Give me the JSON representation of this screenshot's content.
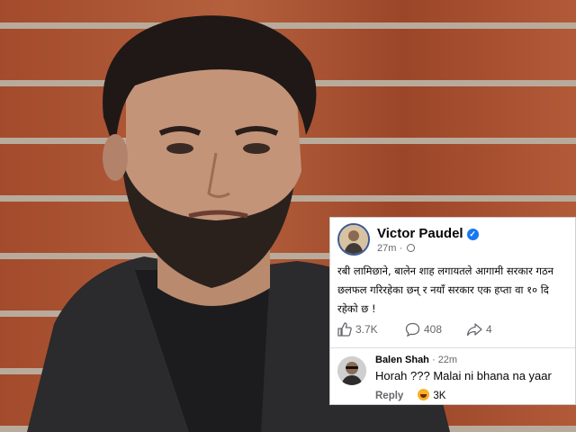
{
  "post": {
    "author": "Victor Paudel",
    "time": "27m",
    "body_lines": [
      "रबी लामिछाने, बालेन शाह लगायतले आगामी सरकार गठन",
      "छलफल गरिरहेका छन् र नयाँ सरकार एक हप्ता वा १० दि",
      "रहेको छ !"
    ],
    "likes": "3.7K",
    "comments": "408",
    "shares": "4"
  },
  "comment": {
    "author": "Balen Shah",
    "time": "22m",
    "text": "Horah ??? Malai ni bhana na yaar",
    "reply_label": "Reply",
    "reaction_count": "3K"
  },
  "icons": {
    "verified": "verified-badge-icon",
    "globe": "globe-icon",
    "like": "thumbs-up-icon",
    "comment": "comment-bubble-icon",
    "share": "share-arrow-icon",
    "reaction": "haha-reaction-icon"
  },
  "colors": {
    "facebook_blue": "#1877f2",
    "meta_gray": "#65676b"
  }
}
